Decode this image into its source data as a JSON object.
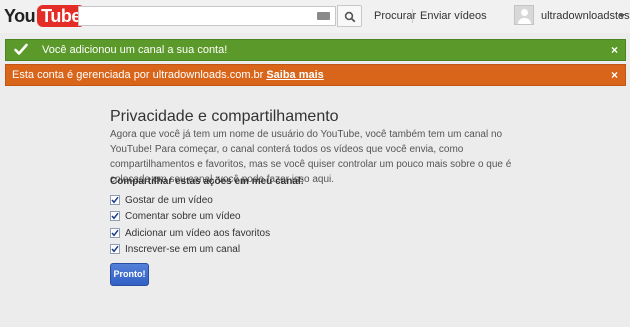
{
  "masthead": {
    "logo": {
      "you": "You",
      "tube": "Tube"
    },
    "search": {
      "placeholder": "",
      "value": ""
    },
    "nav": {
      "procurar": "Procurar",
      "enviar": "Enviar vídeos"
    },
    "user": {
      "name": "ultradownloadsteste"
    }
  },
  "alerts": {
    "success": {
      "text": "Você adicionou um canal a sua conta!",
      "close": "×",
      "color": "#5b9a2a"
    },
    "warning": {
      "text": "Esta conta é gerenciada por ultradownloads.com.br",
      "link": "Saiba mais",
      "close": "×",
      "color": "#d8651a"
    }
  },
  "main": {
    "title": "Privacidade e compartilhamento",
    "intro": "Agora que você já tem um nome de usuário do YouTube, você também tem um canal no YouTube! Para começar, o canal conterá todos os vídeos que você envia, como compartilhamentos e favoritos, mas se você quiser controlar um pouco mais sobre o que é colocado em seu canal, você pode fazer isso aqui.",
    "share_label": "Compartilhar estas ações em meu canal:",
    "options": [
      {
        "label": "Gostar de um vídeo",
        "checked": true
      },
      {
        "label": "Comentar sobre um vídeo",
        "checked": true
      },
      {
        "label": "Adicionar um vídeo aos favoritos",
        "checked": true
      },
      {
        "label": "Inscrever-se em um canal",
        "checked": true
      }
    ],
    "done_button": "Pronto!"
  }
}
